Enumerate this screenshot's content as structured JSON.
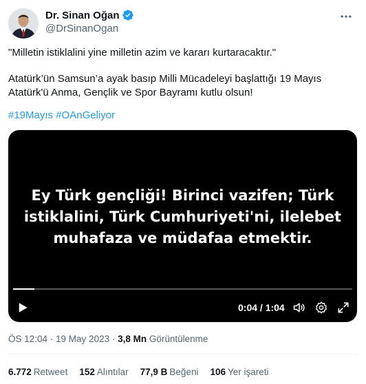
{
  "author": {
    "name": "Dr. Sinan Oğan",
    "handle": "@DrSinanOgan",
    "verified_color": "#1d9bf0"
  },
  "tweet": {
    "line1": "\"Milletin istiklalini yine milletin azim ve kararı kurtaracaktır.\"",
    "line2": "Atatürk’ün Samsun’a ayak basıp Milli Mücadeleyi başlattığı 19 Mayıs",
    "line3": "Atatürk'ü Anma, Gençlik ve Spor Bayramı kutlu olsun!",
    "hashtags": [
      "#19Mayıs",
      "#OAnGeliyor"
    ]
  },
  "video": {
    "caption_lines": [
      "Ey Türk gençliği! Birinci vazifen; Türk",
      "istiklalini, Türk Cumhuriyeti'ni, ilelebet",
      "muhafaza ve müdafaa etmektir."
    ],
    "time": "0:04 / 1:04",
    "progress_fraction": 0.0625,
    "icons": [
      "play-icon",
      "volume-icon",
      "settings-icon",
      "fullscreen-icon"
    ]
  },
  "meta": {
    "timestamp": "ÖS 12:04 · 19 May 2023",
    "separator": " · ",
    "views_count": "3,8 Mn",
    "views_label": "Görüntülenme"
  },
  "stats": [
    {
      "num": "6.772",
      "label": "Retweet"
    },
    {
      "num": "152",
      "label": "Alıntılar"
    },
    {
      "num": "77,9 B",
      "label": "Beğeni"
    },
    {
      "num": "106",
      "label": "Yer işareti"
    }
  ],
  "colors": {
    "text": "#0f1419",
    "secondary": "#536471",
    "accent": "#1d9bf0",
    "video_bg": "#000000"
  }
}
